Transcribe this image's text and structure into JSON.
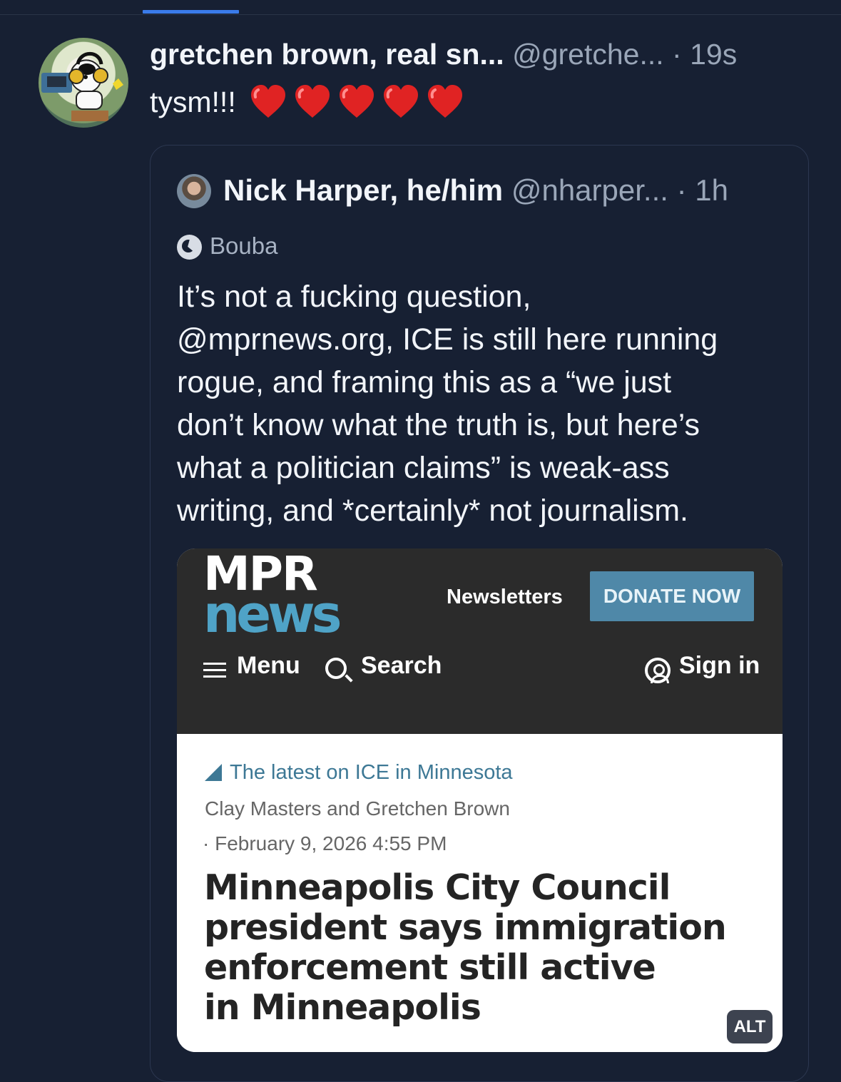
{
  "outer_post": {
    "author": "gretchen brown, real sn...",
    "handle": "@gretche...",
    "separator": "·",
    "timestamp": "19s",
    "text": "tysm!!!",
    "heart_count": 5,
    "heart_color": "#e02323"
  },
  "quoted_post": {
    "author": "Nick Harper, he/him",
    "handle": "@nharper...",
    "separator": "·",
    "timestamp": "1h",
    "label": "Bouba",
    "body_lines": [
      "It’s not a fucking question,",
      "@mprnews.org, ICE is still here running",
      "rogue, and framing this as a “we just",
      "don’t know what the truth is, but here’s",
      "what a politician claims” is weak-ass",
      "writing, and *certainly* not journalism."
    ]
  },
  "embedded_image": {
    "logo_line1": "MPR",
    "logo_line2": "news",
    "newsletters": "Newsletters",
    "donate_button": "DONATE NOW",
    "menu": "Menu",
    "search": "Search",
    "sign_in": "Sign in",
    "category": "The latest on ICE in Minnesota",
    "byline": "Clay Masters and Gretchen Brown",
    "date": "· February 9, 2026 4:55 PM",
    "headline_lines": [
      "Minneapolis City Council",
      "president says immigration",
      "enforcement still active",
      "in Minneapolis"
    ],
    "alt_badge": "ALT",
    "brand_blue": "#4f88a8",
    "header_color": "#2b2b2b"
  },
  "icons": {
    "menu": "hamburger-icon",
    "search": "magnifier-icon",
    "sign_in": "user-circle-icon",
    "category": "triangle-icon",
    "label": "bouba-label-icon",
    "heart": "red-heart-icon"
  }
}
